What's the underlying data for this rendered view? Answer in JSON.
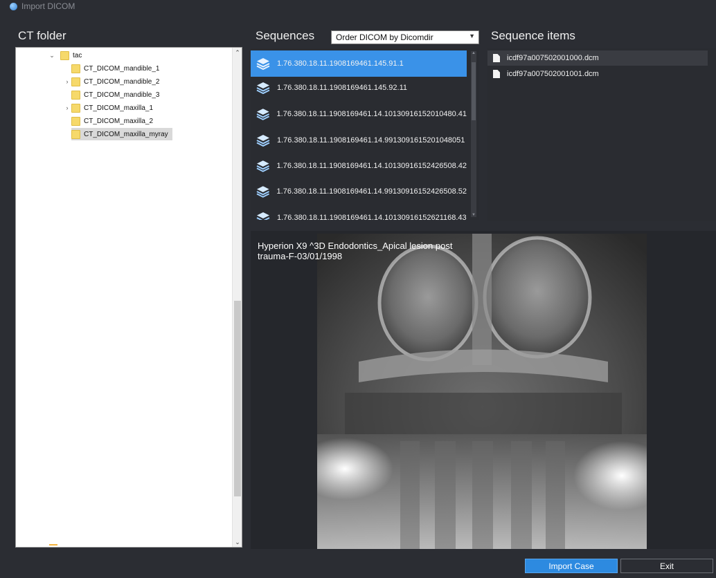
{
  "window": {
    "title": "Import DICOM"
  },
  "ct_folder": {
    "label": "CT folder",
    "tree": [
      {
        "label": "tac",
        "expander": "⌄",
        "level": 0
      },
      {
        "label": "CT_DICOM_mandible_1",
        "expander": "",
        "level": 1
      },
      {
        "label": "CT_DICOM_mandible_2",
        "expander": "›",
        "level": 1
      },
      {
        "label": "CT_DICOM_mandible_3",
        "expander": "",
        "level": 1
      },
      {
        "label": "CT_DICOM_maxilla_1",
        "expander": "›",
        "level": 1
      },
      {
        "label": "CT_DICOM_maxilla_2",
        "expander": "",
        "level": 1
      },
      {
        "label": "CT_DICOM_maxilla_myray",
        "expander": "",
        "level": 1,
        "selected": true
      }
    ]
  },
  "sequences": {
    "label": "Sequences",
    "order_select": {
      "value": "Order DICOM by Dicomdir"
    },
    "items": [
      {
        "label": "1.76.380.18.11.1908169461.145.91.1",
        "selected": true
      },
      {
        "label": "1.76.380.18.11.1908169461.145.92.11"
      },
      {
        "label": "1.76.380.18.11.1908169461.14.10130916152010480.41"
      },
      {
        "label": "1.76.380.18.11.1908169461.14.9913091615201048051"
      },
      {
        "label": "1.76.380.18.11.1908169461.14.10130916152426508.42"
      },
      {
        "label": "1.76.380.18.11.1908169461.14.99130916152426508.52"
      },
      {
        "label": "1.76.380.18.11.1908169461.14.10130916152621168.43"
      }
    ]
  },
  "sequence_items": {
    "label": "Sequence items",
    "files": [
      {
        "label": "icdf97a007502001000.dcm",
        "selected": true
      },
      {
        "label": "icdf97a007502001001.dcm"
      }
    ]
  },
  "preview": {
    "caption": "Hyperion X9 ^3D Endodontics_Apical lesion post trauma-F-03/01/1998"
  },
  "buttons": {
    "import": "Import Case",
    "exit": "Exit"
  },
  "colors": {
    "accent": "#2d8ae0",
    "selection": "#3a92e8",
    "background": "#2b2d33",
    "folder": "#f6d96b"
  }
}
